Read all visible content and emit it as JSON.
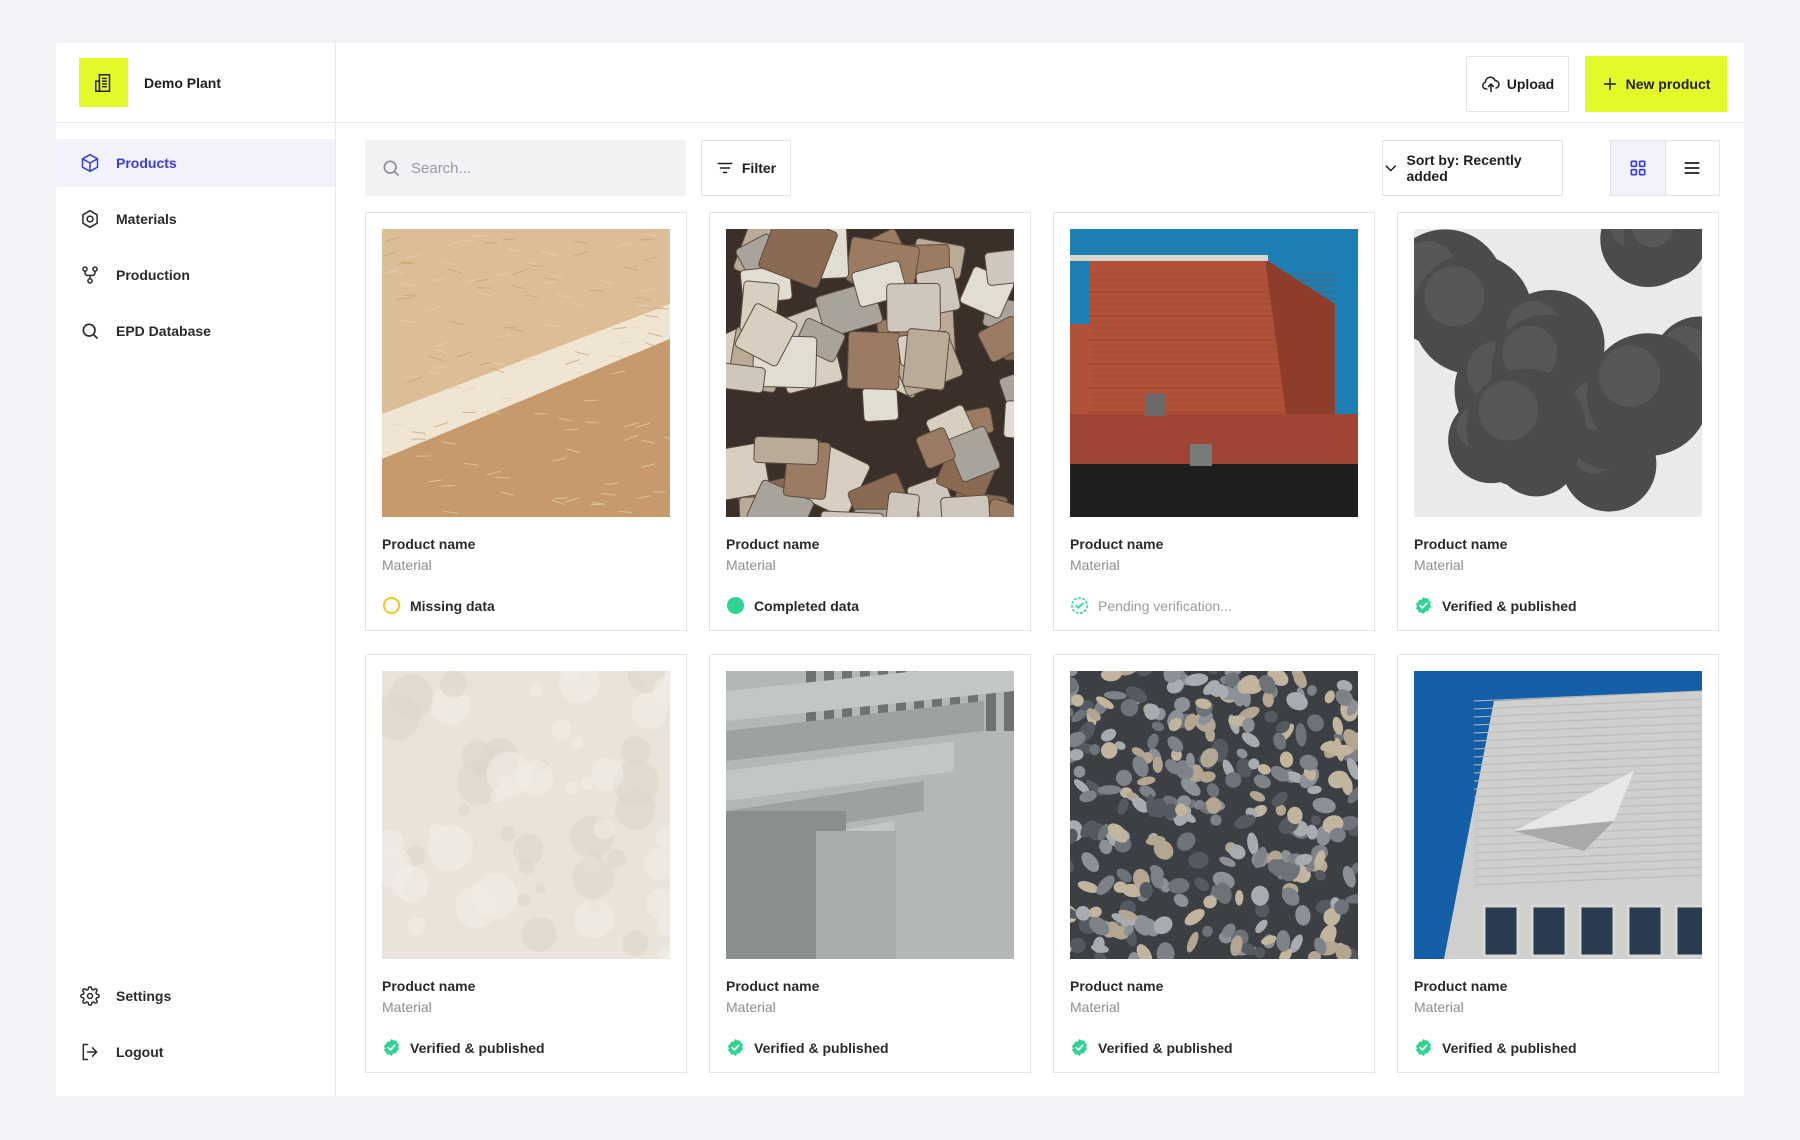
{
  "brand": {
    "name": "Demo Plant",
    "icon": "building-icon",
    "accent": "#e4f92a"
  },
  "sidebar": {
    "items": [
      {
        "label": "Products",
        "icon": "box-icon",
        "active": true
      },
      {
        "label": "Materials",
        "icon": "hexagon-icon",
        "active": false
      },
      {
        "label": "Production",
        "icon": "flow-icon",
        "active": false
      },
      {
        "label": "EPD Database",
        "icon": "search-icon",
        "active": false
      }
    ],
    "bottom": [
      {
        "label": "Settings",
        "icon": "gear-icon"
      },
      {
        "label": "Logout",
        "icon": "logout-icon"
      }
    ]
  },
  "topbar": {
    "upload_label": "Upload",
    "new_label": "New product"
  },
  "toolbar": {
    "search_placeholder": "Search...",
    "filter_label": "Filter",
    "sort_label": "Sort by: Recently added",
    "view_mode": "grid"
  },
  "colors": {
    "active_nav": "#3a3dd8",
    "status_green": "#2fd393",
    "status_yellow": "#f5c518"
  },
  "products": [
    {
      "name": "Product name",
      "material": "Material",
      "status": "Missing data",
      "status_type": "missing",
      "image": "fiberboard"
    },
    {
      "name": "Product name",
      "material": "Material",
      "status": "Completed data",
      "status_type": "completed",
      "image": "rubble"
    },
    {
      "name": "Product name",
      "material": "Material",
      "status": "Pending verification...",
      "status_type": "pending",
      "image": "brick-building"
    },
    {
      "name": "Product name",
      "material": "Material",
      "status": "Verified & published",
      "status_type": "verified",
      "image": "coal-balls"
    },
    {
      "name": "Product name",
      "material": "Material",
      "status": "Verified & published",
      "status_type": "verified",
      "image": "powder"
    },
    {
      "name": "Product name",
      "material": "Material",
      "status": "Verified & published",
      "status_type": "verified",
      "image": "concrete-steps"
    },
    {
      "name": "Product name",
      "material": "Material",
      "status": "Verified & published",
      "status_type": "verified",
      "image": "gravel"
    },
    {
      "name": "Product name",
      "material": "Material",
      "status": "Verified & published",
      "status_type": "verified",
      "image": "facade"
    }
  ]
}
